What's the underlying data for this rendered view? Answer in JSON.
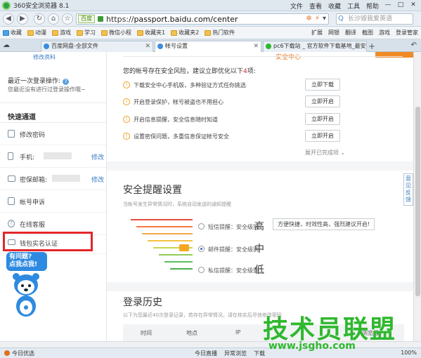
{
  "browser": {
    "title": "360安全浏览器 8.1",
    "menu": [
      "文件",
      "查看",
      "收藏",
      "工具",
      "帮助"
    ],
    "address": {
      "badge": "百度",
      "scheme": "https://",
      "url": "passport.baidu.com/center"
    },
    "search_placeholder": "长沙毁我爱英语"
  },
  "bookmarks": {
    "items": [
      "收藏",
      "动漫",
      "游戏",
      "学习",
      "微信小程",
      "收藏夹1",
      "收藏夹2",
      "热门软件"
    ],
    "right_items": [
      "扩展",
      "网银",
      "翻译",
      "截图",
      "游戏",
      "登录管家"
    ]
  },
  "tabs": [
    {
      "label": "百度网盘-全部文件",
      "active": false
    },
    {
      "label": "帐号设置",
      "active": true
    },
    {
      "label": "pc6下载站 _ 官方软件下载基地_最安全...",
      "active": false
    }
  ],
  "sidebar": {
    "top_link": "修改资料",
    "record_title": "最近一次登录操作:",
    "record_text": "您最近没有进行过登录操作哦~",
    "section_title": "快速通道",
    "items": [
      {
        "label": "修改密码",
        "icon": "lock-icon",
        "action": ""
      },
      {
        "label": "手机:",
        "icon": "phone-icon",
        "action": "修改"
      },
      {
        "label": "密保邮箱:",
        "icon": "mail-icon",
        "action": "修改"
      },
      {
        "label": "帐号申诉",
        "icon": "doc-icon",
        "action": ""
      },
      {
        "label": "在线客服",
        "icon": "question-icon",
        "action": ""
      },
      {
        "label": "钱包实名认证",
        "icon": "id-card-icon",
        "action": ""
      }
    ],
    "bubble": "有问题?\n点我点我!"
  },
  "main": {
    "banner_text": "安全中心",
    "risk_title_prefix": "您的帐号存在安全风险，建议立即优化以下",
    "risk_count": "4",
    "risk_title_suffix": "项:",
    "risks": [
      {
        "text": "下载安全中心手机版，多种验证方式任你挑选",
        "button": "立即下载"
      },
      {
        "text": "开启登录保护，帐号被盗也不用担心",
        "button": "立即开启"
      },
      {
        "text": "开启信息提醒，安全信息随时知道",
        "button": "立即开启"
      },
      {
        "text": "设置密保问题，多重信息保证帐号安全",
        "button": "立即开启"
      }
    ],
    "expand_link": "展开已完成项 ⌄",
    "alert_title": "安全提醒设置",
    "alert_subtitle": "当帐号发生异常情况时，系统自动发送的通知提醒",
    "options": [
      {
        "name": "短信提醒：安全级别",
        "level": "高",
        "selected": false
      },
      {
        "name": "邮件提醒：安全级别",
        "level": "中",
        "selected": true
      },
      {
        "name": "私信提醒：安全级别",
        "level": "低",
        "selected": false
      }
    ],
    "tip": "方便快捷，时效性高，强烈建议开启!",
    "login_title": "登录历史",
    "login_subtitle": "以下为您最近40次登录记录，若存在异常情况，请在核实后尽快修改密码",
    "table_headers": [
      "时间",
      "地点",
      "IP",
      "浏览器"
    ],
    "feedback": "意见反馈"
  },
  "status": {
    "left": "今日优选",
    "mid": [
      "今日直播",
      "异常浏览",
      "下载"
    ],
    "right": "100%"
  },
  "watermark": {
    "big": "技术员联盟",
    "small": "www.jsgho.com"
  },
  "colors": {
    "accent": "#3a7cc3",
    "danger": "#e2262a",
    "warning": "#f0a020",
    "watermark": "#2eb82e"
  }
}
